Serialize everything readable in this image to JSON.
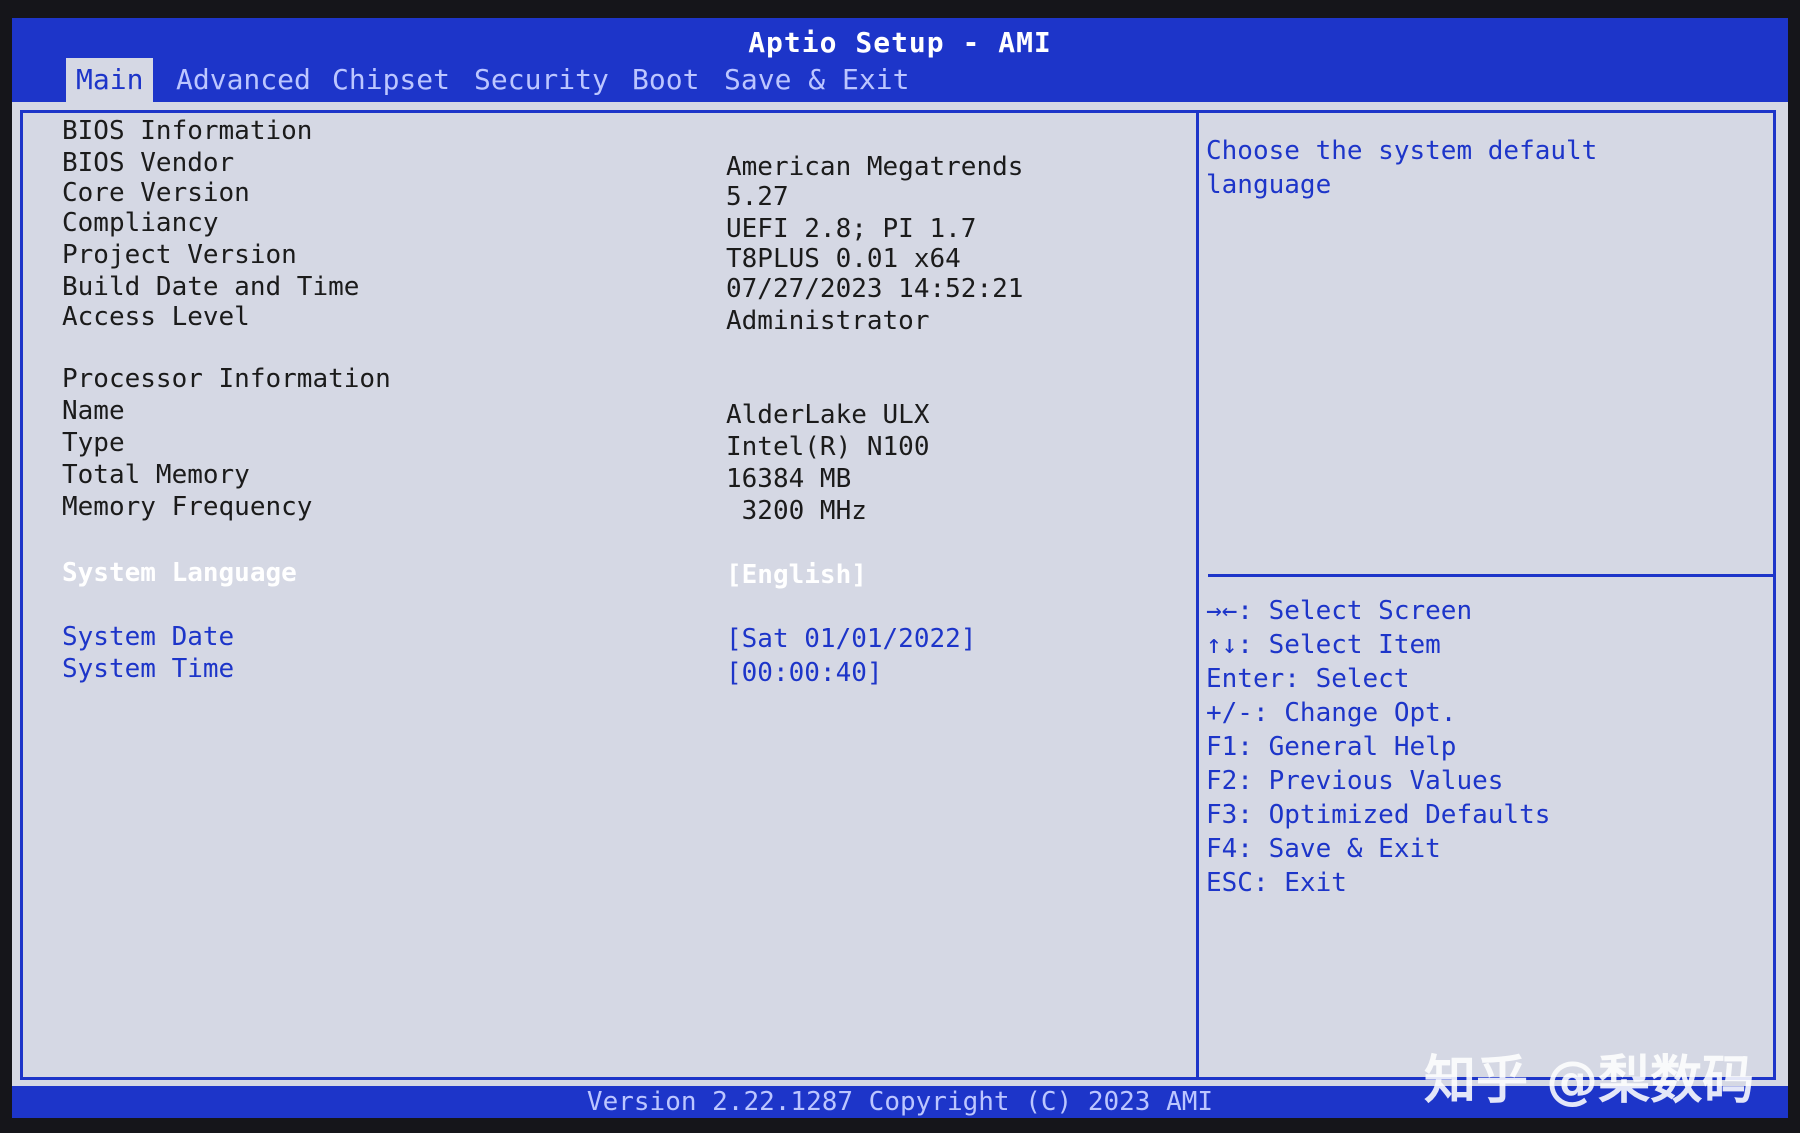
{
  "app_title": "Aptio Setup - AMI",
  "tabs": [
    "Main",
    "Advanced",
    "Chipset",
    "Security",
    "Boot",
    "Save & Exit"
  ],
  "active_tab": "Main",
  "bios_info": {
    "header": "BIOS Information",
    "rows": [
      {
        "label": "BIOS Vendor",
        "value": "American Megatrends"
      },
      {
        "label": "Core Version",
        "value": "5.27"
      },
      {
        "label": "Compliancy",
        "value": "UEFI 2.8; PI 1.7"
      },
      {
        "label": "Project Version",
        "value": "T8PLUS 0.01 x64"
      },
      {
        "label": "Build Date and Time",
        "value": "07/27/2023 14:52:21"
      },
      {
        "label": "Access Level",
        "value": "Administrator"
      }
    ]
  },
  "processor_info": {
    "header": "Processor Information",
    "rows": [
      {
        "label": "Name",
        "value": "AlderLake ULX"
      },
      {
        "label": "Type",
        "value": "Intel(R) N100"
      },
      {
        "label": "Total Memory",
        "value": "16384 MB"
      },
      {
        "label": "Memory Frequency",
        "value": " 3200 MHz"
      }
    ]
  },
  "settings": {
    "language": {
      "label": "System Language",
      "value": "[English]"
    },
    "date": {
      "label": "System Date",
      "value": "[Sat 01/01/2022]"
    },
    "time": {
      "label": "System Time",
      "value": "[00:00:40]"
    }
  },
  "help": {
    "line1": "Choose the system default",
    "line2": "language"
  },
  "keys": [
    "→←: Select Screen",
    "↑↓: Select Item",
    "Enter: Select",
    "+/-: Change Opt.",
    "F1: General Help",
    "F2: Previous Values",
    "F3: Optimized Defaults",
    "F4: Save & Exit",
    "ESC: Exit"
  ],
  "footer": "Version 2.22.1287 Copyright (C) 2023 AMI",
  "watermark": "知乎 @梨数码",
  "colors": {
    "accent": "#1d35c9",
    "background": "#d5d8e4",
    "selected_text": "#ffffff"
  }
}
